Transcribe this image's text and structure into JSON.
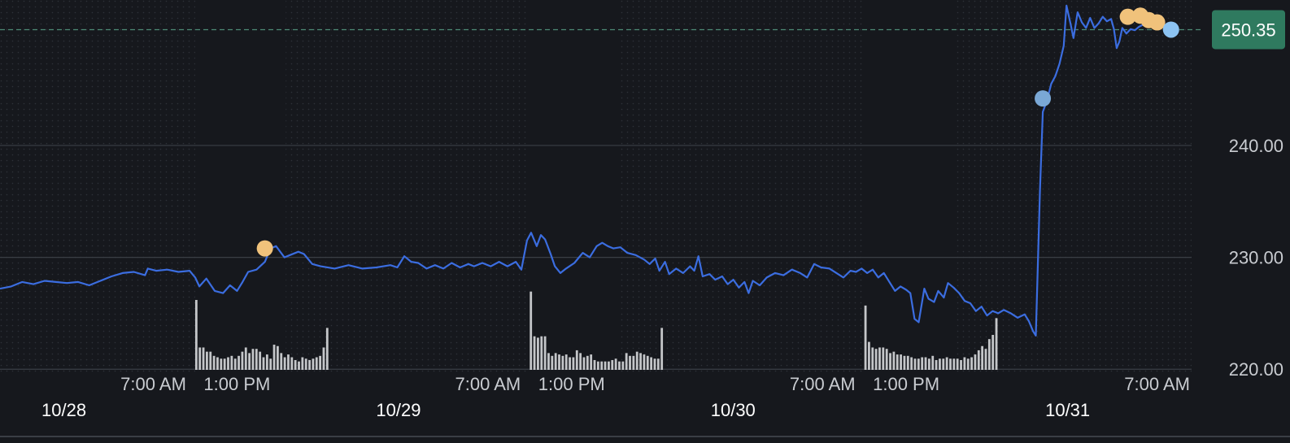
{
  "chart_data": {
    "type": "line",
    "title": "",
    "xlabel": "",
    "ylabel": "",
    "ylim": [
      219,
      253
    ],
    "y_ticks": [
      {
        "value": 220,
        "label": "220.00"
      },
      {
        "value": 230,
        "label": "230.00"
      },
      {
        "value": 240,
        "label": "240.00"
      }
    ],
    "time_labels": [
      {
        "hour": 31,
        "label": "7:00 AM"
      },
      {
        "hour": 37,
        "label": "1:00 PM"
      },
      {
        "hour": 55,
        "label": "7:00 AM"
      },
      {
        "hour": 61,
        "label": "1:00 PM"
      },
      {
        "hour": 79,
        "label": "7:00 AM"
      },
      {
        "hour": 85,
        "label": "1:00 PM"
      },
      {
        "hour": 103,
        "label": "7:00 AM"
      }
    ],
    "date_labels": [
      {
        "hour": 24,
        "label": "10/28"
      },
      {
        "hour": 48,
        "label": "10/29"
      },
      {
        "hour": 72,
        "label": "10/30"
      },
      {
        "hour": 96,
        "label": "10/31"
      }
    ],
    "extended_hours_shading": [
      [
        0,
        34
      ],
      [
        40.5,
        58
      ],
      [
        64.5,
        82
      ],
      [
        88.5,
        106
      ]
    ],
    "current_price": {
      "value": 250.35,
      "label": "250.35",
      "color": "#2f7a5f"
    },
    "line_color": "#3b6de0",
    "series": [
      {
        "points": [
          [
            20,
            227.2
          ],
          [
            20.8,
            227.4
          ],
          [
            21.6,
            227.8
          ],
          [
            22.4,
            227.6
          ],
          [
            23.2,
            227.9
          ],
          [
            24,
            227.8
          ],
          [
            24.8,
            227.7
          ],
          [
            25.6,
            227.8
          ],
          [
            26.4,
            227.5
          ],
          [
            27.2,
            227.9
          ],
          [
            28,
            228.3
          ],
          [
            28.8,
            228.6
          ],
          [
            29.6,
            228.7
          ],
          [
            30.4,
            228.4
          ],
          [
            30.6,
            229.0
          ],
          [
            31.2,
            228.8
          ],
          [
            32,
            228.9
          ],
          [
            32.8,
            228.7
          ],
          [
            33.6,
            228.8
          ],
          [
            34,
            228.2
          ],
          [
            34.3,
            227.4
          ],
          [
            34.8,
            228.1
          ],
          [
            35.4,
            227.0
          ],
          [
            36,
            226.8
          ],
          [
            36.5,
            227.5
          ],
          [
            37,
            227.0
          ],
          [
            37.4,
            227.8
          ],
          [
            37.8,
            228.7
          ],
          [
            38.4,
            228.9
          ],
          [
            39,
            229.6
          ],
          [
            39.4,
            230.8
          ],
          [
            39.8,
            231.0
          ],
          [
            40.4,
            230.0
          ],
          [
            40.8,
            230.2
          ],
          [
            41.4,
            230.5
          ],
          [
            41.8,
            230.3
          ],
          [
            42.4,
            229.4
          ],
          [
            43,
            229.2
          ],
          [
            44,
            229.0
          ],
          [
            45,
            229.3
          ],
          [
            46,
            229.0
          ],
          [
            47,
            229.1
          ],
          [
            48,
            229.3
          ],
          [
            48.5,
            229.1
          ],
          [
            49,
            230.1
          ],
          [
            49.5,
            229.6
          ],
          [
            50,
            229.5
          ],
          [
            50.6,
            229.0
          ],
          [
            51.2,
            229.3
          ],
          [
            51.8,
            229.0
          ],
          [
            52.4,
            229.5
          ],
          [
            53,
            229.1
          ],
          [
            53.6,
            229.4
          ],
          [
            54,
            229.2
          ],
          [
            54.6,
            229.5
          ],
          [
            55.2,
            229.2
          ],
          [
            55.8,
            229.6
          ],
          [
            56.4,
            229.2
          ],
          [
            57,
            229.6
          ],
          [
            57.4,
            228.9
          ],
          [
            57.8,
            231.5
          ],
          [
            58.1,
            232.2
          ],
          [
            58.5,
            231.0
          ],
          [
            58.8,
            232.0
          ],
          [
            59.1,
            231.6
          ],
          [
            59.5,
            230.3
          ],
          [
            59.8,
            229.2
          ],
          [
            60.2,
            228.6
          ],
          [
            60.6,
            229.0
          ],
          [
            61.2,
            229.5
          ],
          [
            61.8,
            230.4
          ],
          [
            62.3,
            230.0
          ],
          [
            62.8,
            231.0
          ],
          [
            63.2,
            231.3
          ],
          [
            63.6,
            231.0
          ],
          [
            64,
            230.8
          ],
          [
            64.5,
            230.9
          ],
          [
            65,
            230.4
          ],
          [
            65.6,
            230.2
          ],
          [
            66.2,
            229.8
          ],
          [
            66.6,
            229.4
          ],
          [
            67,
            229.9
          ],
          [
            67.3,
            228.8
          ],
          [
            67.7,
            229.6
          ],
          [
            68,
            228.5
          ],
          [
            68.5,
            229.0
          ],
          [
            69,
            228.6
          ],
          [
            69.5,
            229.2
          ],
          [
            69.8,
            228.8
          ],
          [
            70.1,
            230.1
          ],
          [
            70.4,
            228.3
          ],
          [
            70.9,
            228.5
          ],
          [
            71.3,
            228.0
          ],
          [
            71.8,
            228.3
          ],
          [
            72.2,
            227.6
          ],
          [
            72.6,
            228.0
          ],
          [
            73,
            227.3
          ],
          [
            73.4,
            227.8
          ],
          [
            73.7,
            226.8
          ],
          [
            74,
            227.9
          ],
          [
            74.5,
            227.5
          ],
          [
            75,
            228.2
          ],
          [
            75.6,
            228.6
          ],
          [
            76.2,
            228.4
          ],
          [
            76.8,
            228.9
          ],
          [
            77.4,
            228.6
          ],
          [
            77.9,
            228.2
          ],
          [
            78.4,
            229.4
          ],
          [
            78.9,
            229.1
          ],
          [
            79.5,
            229.0
          ],
          [
            80,
            228.6
          ],
          [
            80.5,
            228.2
          ],
          [
            81,
            228.8
          ],
          [
            81.4,
            228.7
          ],
          [
            81.8,
            229.0
          ],
          [
            82.2,
            228.6
          ],
          [
            82.6,
            228.9
          ],
          [
            83,
            228.2
          ],
          [
            83.4,
            228.6
          ],
          [
            83.8,
            227.8
          ],
          [
            84.2,
            227.0
          ],
          [
            84.6,
            227.4
          ],
          [
            85,
            227.1
          ],
          [
            85.3,
            226.8
          ],
          [
            85.6,
            224.5
          ],
          [
            85.9,
            224.2
          ],
          [
            86.3,
            227.2
          ],
          [
            86.6,
            226.3
          ],
          [
            87,
            226.0
          ],
          [
            87.3,
            227.0
          ],
          [
            87.7,
            226.4
          ],
          [
            88,
            227.7
          ],
          [
            88.4,
            227.3
          ],
          [
            88.8,
            226.8
          ],
          [
            89.2,
            226.1
          ],
          [
            89.6,
            225.9
          ],
          [
            90,
            225.2
          ],
          [
            90.4,
            225.6
          ],
          [
            90.8,
            224.8
          ],
          [
            91.2,
            225.2
          ],
          [
            91.6,
            225.0
          ],
          [
            92,
            225.3
          ],
          [
            92.5,
            225.0
          ],
          [
            93,
            224.6
          ],
          [
            93.5,
            224.9
          ],
          [
            93.8,
            224.3
          ],
          [
            94.1,
            223.4
          ],
          [
            94.3,
            223.0
          ],
          [
            94.6,
            236.0
          ],
          [
            94.8,
            243.0
          ],
          [
            95.1,
            244.0
          ],
          [
            95.4,
            245.5
          ],
          [
            95.7,
            246.2
          ],
          [
            96,
            247.3
          ],
          [
            96.3,
            248.9
          ],
          [
            96.5,
            252.5
          ],
          [
            96.8,
            250.8
          ],
          [
            97,
            249.6
          ],
          [
            97.3,
            251.9
          ],
          [
            97.6,
            251.0
          ],
          [
            97.9,
            250.5
          ],
          [
            98.2,
            251.4
          ],
          [
            98.5,
            250.5
          ],
          [
            98.8,
            250.9
          ],
          [
            99.1,
            251.5
          ],
          [
            99.4,
            251.1
          ],
          [
            99.7,
            251.3
          ],
          [
            99.9,
            250.4
          ],
          [
            100.1,
            248.7
          ],
          [
            100.3,
            249.3
          ],
          [
            100.5,
            250.5
          ],
          [
            100.8,
            250.0
          ],
          [
            101.1,
            250.4
          ],
          [
            101.4,
            250.3
          ],
          [
            101.7,
            250.6
          ],
          [
            102,
            250.8
          ],
          [
            102.3,
            250.6
          ],
          [
            102.6,
            251.0
          ],
          [
            102.9,
            251.1
          ],
          [
            103.2,
            250.9
          ],
          [
            103.6,
            250.7
          ],
          [
            104,
            250.35
          ]
        ]
      }
    ],
    "event_markers": [
      {
        "hour": 39,
        "value": 230.8,
        "color": "#f0c27b"
      },
      {
        "hour": 94.8,
        "value": 244.2,
        "color": "#7aa8d6"
      },
      {
        "hour": 100.9,
        "value": 251.5,
        "color": "#f0c27b"
      },
      {
        "hour": 101.8,
        "value": 251.6,
        "color": "#f0c27b"
      },
      {
        "hour": 102.4,
        "value": 251.2,
        "color": "#f0c27b"
      },
      {
        "hour": 103,
        "value": 251.0,
        "color": "#f0c27b"
      },
      {
        "hour": 104,
        "value": 250.35,
        "color": "#8cc3f2"
      }
    ],
    "volume_groups": [
      {
        "start_hour": 34,
        "bars": [
          100,
          32,
          32,
          26,
          26,
          20,
          18,
          16,
          16,
          18,
          20,
          16,
          20,
          26,
          32,
          24,
          30,
          30,
          26,
          18,
          22,
          16,
          36,
          34,
          24,
          18,
          22,
          18,
          14,
          12,
          18,
          16,
          14,
          16,
          18,
          20,
          32,
          60
        ]
      },
      {
        "start_hour": 58,
        "bars": [
          112,
          48,
          46,
          48,
          48,
          24,
          20,
          24,
          22,
          20,
          22,
          18,
          18,
          28,
          24,
          18,
          20,
          22,
          14,
          12,
          12,
          12,
          12,
          14,
          16,
          12,
          12,
          24,
          20,
          20,
          26,
          24,
          22,
          20,
          18,
          16,
          16,
          60
        ]
      },
      {
        "start_hour": 82,
        "bars": [
          92,
          40,
          32,
          30,
          32,
          32,
          30,
          24,
          26,
          22,
          22,
          20,
          20,
          18,
          16,
          16,
          18,
          18,
          16,
          20,
          14,
          16,
          16,
          18,
          16,
          16,
          16,
          14,
          18,
          16,
          18,
          22,
          28,
          34,
          30,
          44,
          50,
          74
        ]
      }
    ]
  }
}
